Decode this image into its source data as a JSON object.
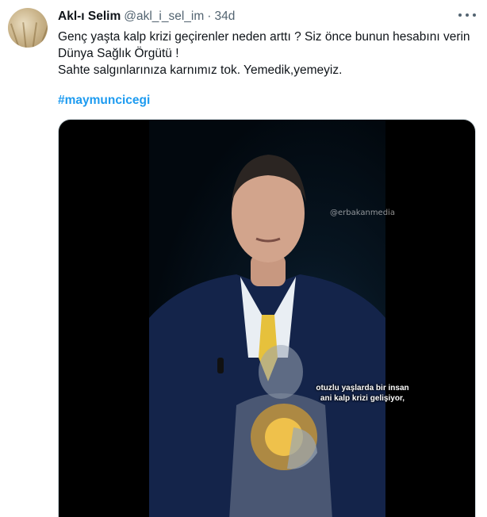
{
  "tweet": {
    "display_name": "Akl-ı Selim",
    "handle": "@akl_i_sel_im",
    "separator": "·",
    "time": "34d",
    "text_lines": [
      "Genç yaşta kalp krizi geçirenler neden arttı ? Siz önce bunun hesabını verin",
      "Dünya Sağlık Örgütü !",
      "Sahte salgınlarınıza karnımız tok. Yemedik,yemeyiz."
    ],
    "hashtag": "#maymuncicegi"
  },
  "media": {
    "watermark": "@erbakanmedia",
    "subtitle_lines": [
      "otuzlu yaşlarda bir insan",
      "ani kalp krizi gelişiyor,"
    ]
  },
  "icons": {
    "more": "more-options-icon",
    "avatar": "wheat-field-avatar"
  },
  "colors": {
    "link": "#1d9bf0",
    "secondary_text": "#536471",
    "primary_text": "#0f1419"
  }
}
